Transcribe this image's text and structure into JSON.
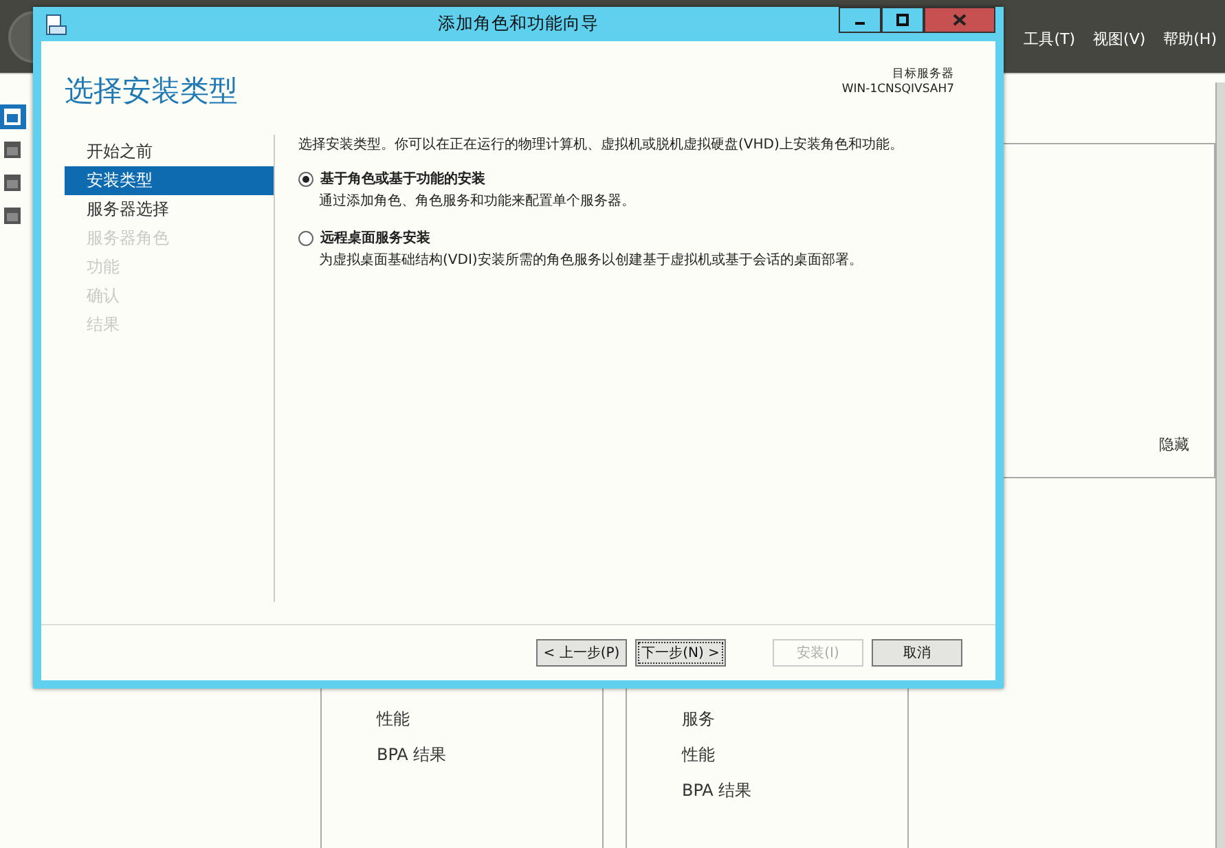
{
  "background_window": {
    "menu": [
      "工具(T)",
      "视图(V)",
      "帮助(H)"
    ],
    "sidebar": [
      {
        "selected": true
      },
      {
        "selected": false
      },
      {
        "selected": false
      },
      {
        "selected": false
      }
    ],
    "panel": {
      "hide_link": "隐藏"
    },
    "tiles": [
      {
        "items": [
          "性能",
          "BPA 结果"
        ]
      },
      {
        "items": [
          "服务",
          "性能",
          "BPA 结果"
        ]
      }
    ]
  },
  "dialog": {
    "title": "添加角色和功能向导",
    "heading": "选择安装类型",
    "target_server": {
      "label": "目标服务器",
      "name": "WIN-1CNSQIVSAH7"
    },
    "nav": [
      {
        "label": "开始之前",
        "selected": false,
        "disabled": false
      },
      {
        "label": "安装类型",
        "selected": true,
        "disabled": false
      },
      {
        "label": "服务器选择",
        "selected": false,
        "disabled": false
      },
      {
        "label": "服务器角色",
        "selected": false,
        "disabled": true
      },
      {
        "label": "功能",
        "selected": false,
        "disabled": true
      },
      {
        "label": "确认",
        "selected": false,
        "disabled": true
      },
      {
        "label": "结果",
        "selected": false,
        "disabled": true
      }
    ],
    "intro": "选择安装类型。你可以在正在运行的物理计算机、虚拟机或脱机虚拟硬盘(VHD)上安装角色和功能。",
    "options": [
      {
        "label": "基于角色或基于功能的安装",
        "description": "通过添加角色、角色服务和功能来配置单个服务器。",
        "selected": true
      },
      {
        "label": "远程桌面服务安装",
        "description": "为虚拟桌面基础结构(VDI)安装所需的角色服务以创建基于虚拟机或基于会话的桌面部署。",
        "selected": false
      }
    ],
    "buttons": [
      {
        "label": "< 上一步(P)",
        "disabled": false,
        "focused": false
      },
      {
        "label": "下一步(N) >",
        "disabled": false,
        "focused": true
      },
      {
        "label": "安装(I)",
        "disabled": true,
        "focused": false
      },
      {
        "label": "取消",
        "disabled": false,
        "focused": false
      }
    ]
  }
}
